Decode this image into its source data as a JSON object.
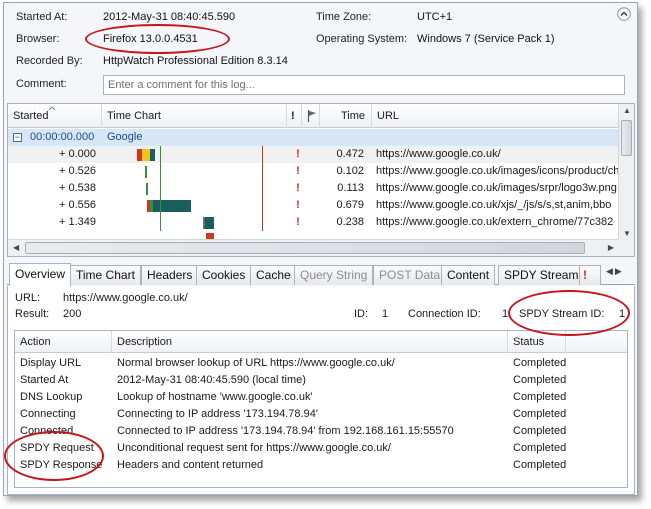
{
  "summary": {
    "started_at_label": "Started At:",
    "started_at_value": "2012-May-31 08:40:45.590",
    "browser_label": "Browser:",
    "browser_value": "Firefox 13.0.0.4531",
    "recorded_by_label": "Recorded By:",
    "recorded_by_value": "HttpWatch Professional Edition 8.3.14",
    "comment_label": "Comment:",
    "comment_placeholder": "Enter a comment for this log...",
    "time_zone_label": "Time Zone:",
    "time_zone_value": "UTC+1",
    "os_label": "Operating System:",
    "os_value": "Windows 7 (Service Pack 1)"
  },
  "grid": {
    "headers": {
      "started": "Started",
      "time_chart": "Time Chart",
      "warning": "!",
      "time": "Time",
      "url": "URL"
    },
    "group": {
      "expander": "−",
      "start": "00:00:00.000",
      "name": "Google"
    },
    "rows": [
      {
        "start": "+ 0.000",
        "warning": "!",
        "time": "0.472",
        "url": "https://www.google.co.uk/"
      },
      {
        "start": "+ 0.526",
        "warning": "!",
        "time": "0.102",
        "url": "https://www.google.co.uk/images/icons/product/ch"
      },
      {
        "start": "+ 0.538",
        "warning": "!",
        "time": "0.113",
        "url": "https://www.google.co.uk/images/srpr/logo3w.png"
      },
      {
        "start": "+ 0.556",
        "warning": "!",
        "time": "0.679",
        "url": "https://www.google.co.uk/xjs/_/js/s/s,st,anim,bbo"
      },
      {
        "start": "+ 1.349",
        "warning": "!",
        "time": "0.238",
        "url": "https://www.google.co.uk/extern_chrome/77c382"
      }
    ]
  },
  "tabs": [
    {
      "label": "Overview",
      "active": true
    },
    {
      "label": "Time Chart"
    },
    {
      "label": "Headers"
    },
    {
      "label": "Cookies"
    },
    {
      "label": "Cache"
    },
    {
      "label": "Query String",
      "disabled": true
    },
    {
      "label": "POST Data",
      "disabled": true
    },
    {
      "label": "Content"
    },
    {
      "label": "SPDY Stream"
    }
  ],
  "overview": {
    "url_label": "URL:",
    "url_value": "https://www.google.co.uk/",
    "result_label": "Result:",
    "result_value": "200",
    "id_label": "ID:",
    "id_value": "1",
    "connection_id_label": "Connection ID:",
    "connection_id_value": "1",
    "spdy_stream_id_label": "SPDY Stream ID:",
    "spdy_stream_id_value": "1",
    "table_headers": {
      "action": "Action",
      "description": "Description",
      "status": "Status"
    },
    "rows": [
      {
        "action": "Display URL",
        "description": "Normal browser lookup of URL https://www.google.co.uk/",
        "status": "Completed"
      },
      {
        "action": "Started At",
        "description": "2012-May-31 08:40:45.590 (local time)",
        "status": "Completed"
      },
      {
        "action": "DNS Lookup",
        "description": "Lookup of hostname 'www.google.co.uk'",
        "status": "Completed"
      },
      {
        "action": "Connecting",
        "description": "Connecting to IP address '173.194.78.94'",
        "status": "Completed"
      },
      {
        "action": "Connected",
        "description": "Connected to IP address '173.194.78.94' from 192.168.161.15:55570",
        "status": "Completed"
      },
      {
        "action": "SPDY Request",
        "description": "Unconditional request sent for https://www.google.co.uk/",
        "status": "Completed"
      },
      {
        "action": "SPDY Response",
        "description": "Headers and content returned",
        "status": "Completed"
      }
    ]
  },
  "colors": {
    "annotation": "#c4161c",
    "warning": "#d12a1e",
    "group_row": "#d7e7f7",
    "timing_blocked": "#cc3a1e",
    "timing_wait": "#f0c419",
    "timing_receive": "#1b5e5e",
    "timing_green": "#3b8f3b"
  },
  "icons": {
    "corner_button": "chevron-up-icon",
    "flag": "flag-icon",
    "tab_overflow": "warning-tab-icon"
  }
}
